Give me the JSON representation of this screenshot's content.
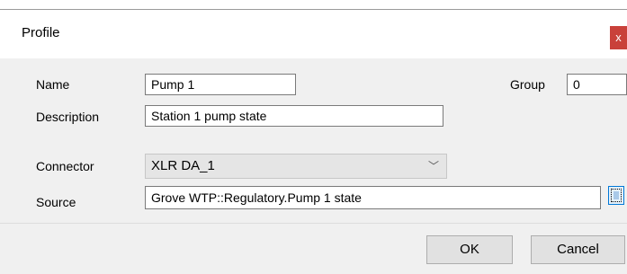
{
  "window": {
    "title": "Profile",
    "close_label": "x"
  },
  "form": {
    "name": {
      "label": "Name",
      "value": "Pump 1"
    },
    "group": {
      "label": "Group",
      "value": "0"
    },
    "description": {
      "label": "Description",
      "value": "Station 1 pump state"
    },
    "connector": {
      "label": "Connector",
      "selected": "XLR DA_1"
    },
    "source": {
      "label": "Source",
      "value": "Grove WTP::Regulatory.Pump 1 state"
    }
  },
  "buttons": {
    "ok": "OK",
    "cancel": "Cancel"
  },
  "icons": {
    "close": "close-icon",
    "dropdown": "chevron-down-icon",
    "browse": "browse-icon"
  }
}
